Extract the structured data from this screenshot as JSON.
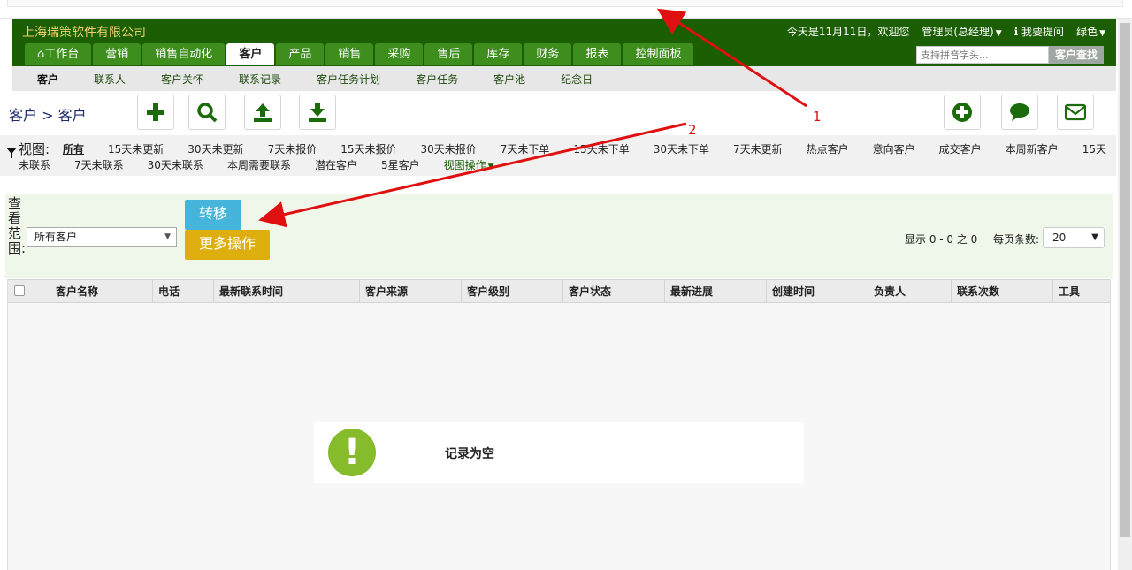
{
  "header": {
    "company": "上海瑞策软件有限公司",
    "date_greeting": "今天是11月11日，欢迎您",
    "user": "管理员(总经理)",
    "help": "我要提问",
    "theme": "绿色"
  },
  "tabs": [
    {
      "label": "工作台"
    },
    {
      "label": "营销"
    },
    {
      "label": "销售自动化"
    },
    {
      "label": "客户"
    },
    {
      "label": "产品"
    },
    {
      "label": "销售"
    },
    {
      "label": "采购"
    },
    {
      "label": "售后"
    },
    {
      "label": "库存"
    },
    {
      "label": "财务"
    },
    {
      "label": "报表"
    },
    {
      "label": "控制面板"
    }
  ],
  "search": {
    "placeholder": "支持拼音字头...",
    "value": "支持拼音字头...",
    "button": "客户查找"
  },
  "subnav": [
    "客户",
    "联系人",
    "客户关怀",
    "联系记录",
    "客户任务计划",
    "客户任务",
    "客户池",
    "纪念日"
  ],
  "breadcrumb": "客户 > 客户",
  "toolbar_icons": [
    "add-icon",
    "search-icon",
    "upload-icon",
    "download-icon",
    "plus-circle-icon",
    "chat-icon",
    "mail-icon"
  ],
  "views": {
    "label": "视图:",
    "row1": [
      "所有",
      "15天未更新",
      "30天未更新",
      "7天未报价",
      "15天未报价",
      "30天未报价",
      "7天未下单",
      "15天未下单",
      "30天未下单",
      "7天未更新",
      "热点客户",
      "意向客户",
      "成交客户",
      "本周新客户",
      "15天"
    ],
    "row2": [
      "未联系",
      "7天未联系",
      "30天未联系",
      "本周需要联系",
      "潜在客户",
      "5星客户"
    ],
    "op": "视图操作"
  },
  "filter": {
    "scope_label": "查看范围:",
    "scope_value": "所有客户",
    "transfer": "转移",
    "more": "更多操作",
    "pager_info": "显示 0 - 0 之 0",
    "perpage_label": "每页条数:",
    "perpage_value": "20"
  },
  "columns": [
    "客户名称",
    "电话",
    "最新联系时间",
    "客户来源",
    "客户级别",
    "客户状态",
    "最新进展",
    "创建时间",
    "负责人",
    "联系次数",
    "工具"
  ],
  "empty_text": "记录为空",
  "annotations": [
    "1",
    "2"
  ],
  "colors": {
    "brand": "#1b5e04",
    "tab": "#3d8e1d",
    "transfer": "#46b5dc",
    "more": "#ddae0d",
    "empty_icon": "#86bb2c",
    "arrow": "#e01010"
  }
}
